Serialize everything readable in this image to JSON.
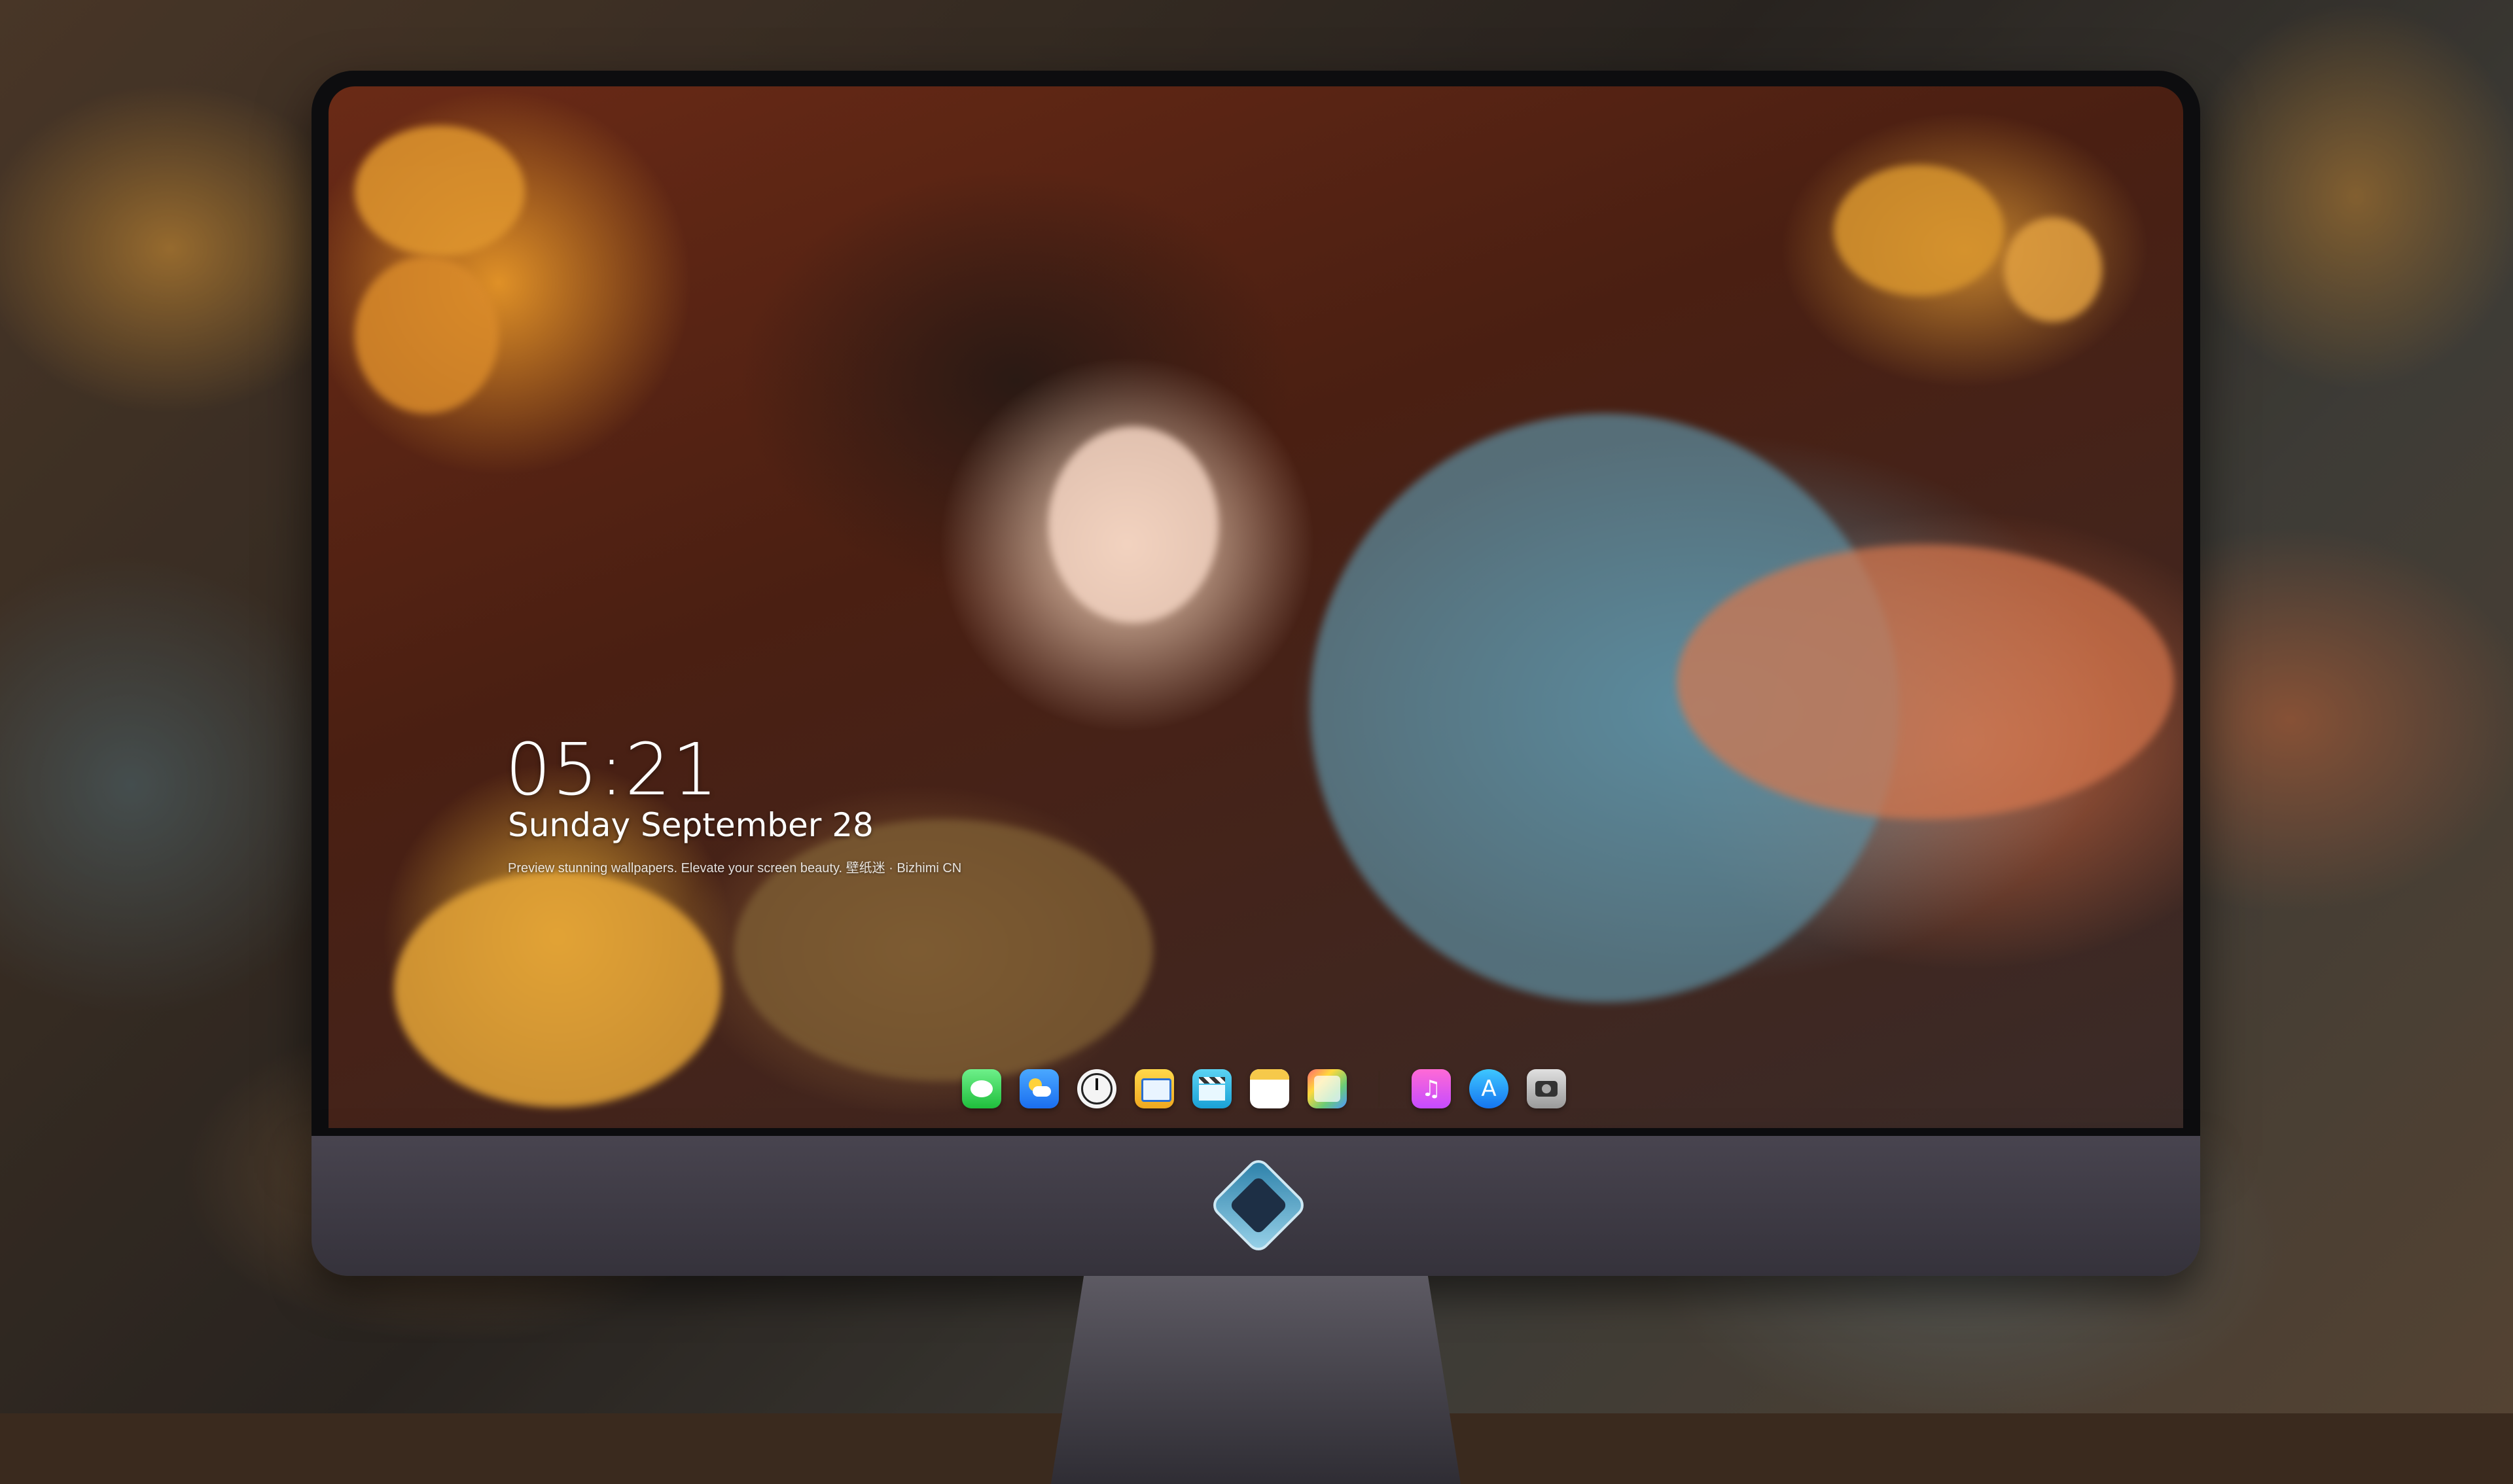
{
  "lockscreen": {
    "time": "05:21",
    "date": "Sunday September  28",
    "caption": "Preview stunning wallpapers. Elevate your screen beauty. 壁纸迷 · Bizhimi CN"
  },
  "dock": {
    "apps": [
      {
        "name": "messages-icon",
        "glyph": ""
      },
      {
        "name": "weather-icon",
        "glyph": ""
      },
      {
        "name": "clock-icon",
        "glyph": ""
      },
      {
        "name": "finder-icon",
        "glyph": ""
      },
      {
        "name": "video-clapper-icon",
        "glyph": ""
      },
      {
        "name": "notes-icon",
        "glyph": ""
      },
      {
        "name": "photos-icon",
        "glyph": ""
      }
    ],
    "apps_right": [
      {
        "name": "music-icon",
        "glyph": "♫"
      },
      {
        "name": "app-store-icon",
        "glyph": "A"
      },
      {
        "name": "camera-icon",
        "glyph": ""
      }
    ]
  },
  "colors": {
    "monitor_bezel": "#0d0d0f",
    "monitor_chin": "#3f3c46",
    "lock_text": "#ffffff"
  }
}
